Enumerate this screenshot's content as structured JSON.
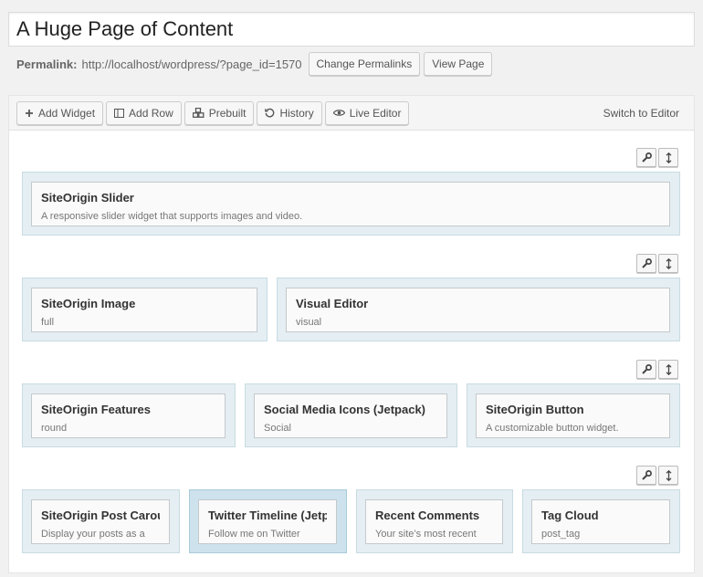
{
  "page": {
    "title": "A Huge Page of Content",
    "permalink_label": "Permalink:",
    "permalink_url": "http://localhost/wordpress/?page_id=1570",
    "change_permalinks": "Change Permalinks",
    "view_page": "View Page"
  },
  "toolbar": {
    "add_widget": "Add Widget",
    "add_row": "Add Row",
    "prebuilt": "Prebuilt",
    "history": "History",
    "live_editor": "Live Editor",
    "switch_to_editor": "Switch to Editor"
  },
  "rows": [
    {
      "widgets": [
        {
          "title": "SiteOrigin Slider",
          "desc": "A responsive slider widget that supports images and video."
        }
      ]
    },
    {
      "widgets": [
        {
          "title": "SiteOrigin Image",
          "desc": "full"
        },
        {
          "title": "Visual Editor",
          "desc": "visual"
        }
      ]
    },
    {
      "widgets": [
        {
          "title": "SiteOrigin Features",
          "desc": "round"
        },
        {
          "title": "Social Media Icons (Jetpack)",
          "desc": "Social"
        },
        {
          "title": "SiteOrigin Button",
          "desc": "A customizable button widget."
        }
      ]
    },
    {
      "widgets": [
        {
          "title": "SiteOrigin Post Carousel",
          "desc": "Display your posts as a"
        },
        {
          "title": "Twitter Timeline (Jetpack)",
          "desc": "Follow me on Twitter"
        },
        {
          "title": "Recent Comments",
          "desc": "Your site’s most recent"
        },
        {
          "title": "Tag Cloud",
          "desc": "post_tag"
        }
      ]
    }
  ],
  "icons": {
    "row_edit": "wrench-icon",
    "row_move": "move-vertical-icon"
  }
}
